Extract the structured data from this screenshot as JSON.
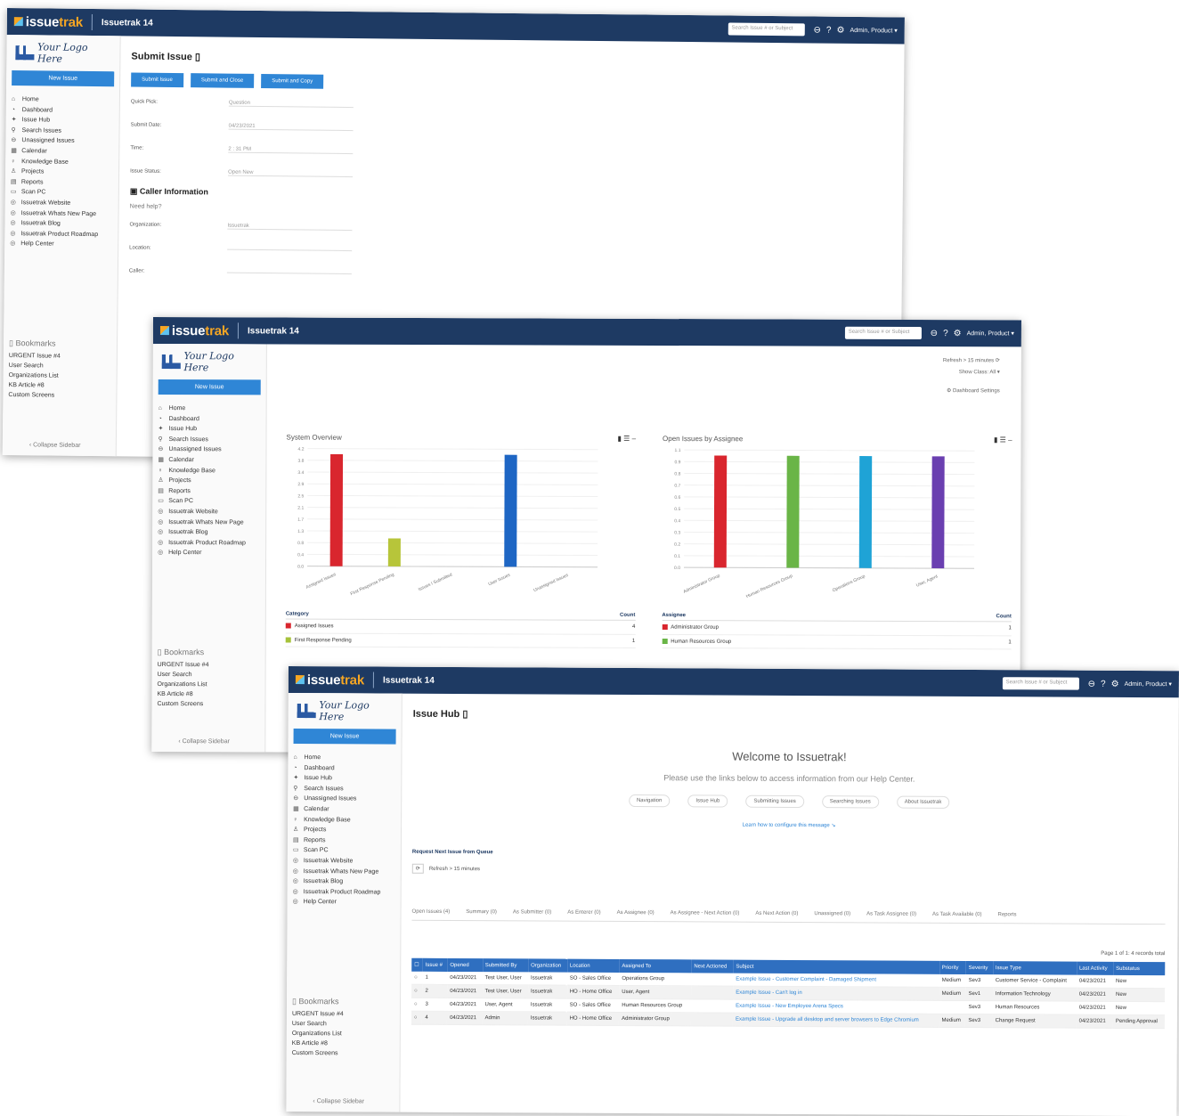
{
  "app": {
    "brand_issue": "issue",
    "brand_trak": "trak",
    "version": "Issuetrak 14",
    "search_placeholder": "Search Issue # or Subject",
    "user_menu": "Admin, Product ▾"
  },
  "sidebar": {
    "logo_text": "Your Logo Here",
    "new_issue": "New Issue",
    "items": [
      {
        "icon": "⌂",
        "label": "Home"
      },
      {
        "icon": "◔",
        "label": "Dashboard"
      },
      {
        "icon": "✦",
        "label": "Issue Hub"
      },
      {
        "icon": "⚲",
        "label": "Search Issues"
      },
      {
        "icon": "⊖",
        "label": "Unassigned Issues"
      },
      {
        "icon": "▦",
        "label": "Calendar"
      },
      {
        "icon": "♀",
        "label": "Knowledge Base"
      },
      {
        "icon": "♙",
        "label": "Projects"
      },
      {
        "icon": "▤",
        "label": "Reports"
      },
      {
        "icon": "▭",
        "label": "Scan PC"
      },
      {
        "icon": "◎",
        "label": "Issuetrak Website"
      },
      {
        "icon": "◎",
        "label": "Issuetrak Whats New Page"
      },
      {
        "icon": "◎",
        "label": "Issuetrak Blog"
      },
      {
        "icon": "◎",
        "label": "Issuetrak Product Roadmap"
      },
      {
        "icon": "◎",
        "label": "Help Center"
      }
    ],
    "bookmarks_title": "Bookmarks",
    "bookmarks": [
      "URGENT Issue #4",
      "User Search",
      "Organizations List",
      "KB Article #8",
      "Custom Screens"
    ],
    "collapse": "‹ Collapse Sidebar"
  },
  "submit": {
    "title": "Submit Issue",
    "buttons": [
      "Submit Issue",
      "Submit and Close",
      "Submit and Copy"
    ],
    "fields": [
      {
        "label": "Quick Pick:",
        "value": "Question"
      },
      {
        "label": "Submit Date:",
        "value": "04/23/2021"
      },
      {
        "label": "Time:",
        "value": "2 : 31 PM"
      },
      {
        "label": "Issue Status:",
        "value": "Open      New"
      }
    ],
    "caller_section": "Caller Information",
    "need_help": "Need help?",
    "caller_fields": [
      {
        "label": "Organization:",
        "value": "Issuetrak"
      },
      {
        "label": "Location:",
        "value": ""
      },
      {
        "label": "Caller:",
        "value": ""
      }
    ]
  },
  "dashboard": {
    "show_class_label": "Show Class:",
    "show_class_value": "All",
    "refresh": "Refresh > 15 minutes",
    "settings": "Dashboard Settings",
    "panels": [
      {
        "title": "System Overview",
        "legend_head": "Category",
        "count_head": "Count",
        "rows": [
          {
            "name": "Assigned Issues",
            "count": "4",
            "color": "#d9262e"
          },
          {
            "name": "First Response Pending",
            "count": "1",
            "color": "#a6c23a"
          }
        ]
      },
      {
        "title": "Open Issues by Assignee",
        "legend_head": "Assignee",
        "count_head": "Count",
        "rows": [
          {
            "name": "Administrator Group",
            "count": "1",
            "color": "#d9262e"
          },
          {
            "name": "Human Resources Group",
            "count": "1",
            "color": "#6ab547"
          }
        ]
      }
    ]
  },
  "chart_data": [
    {
      "type": "bar",
      "title": "System Overview",
      "categories": [
        "Assigned Issues",
        "First Response Pending",
        "Issues I Submitted",
        "User Issues",
        "Unassigned Issues"
      ],
      "values": [
        4,
        1,
        0,
        4,
        0
      ],
      "colors": [
        "#d9262e",
        "#b7c53a",
        "#3a7fd0",
        "#1e66c4",
        "#888888"
      ],
      "ylim": [
        0,
        4.2
      ]
    },
    {
      "type": "bar",
      "title": "Open Issues by Assignee",
      "categories": [
        "Administrator Group",
        "Human Resources Group",
        "Operations Group",
        "User, Agent"
      ],
      "values": [
        1,
        1,
        1,
        1
      ],
      "colors": [
        "#d9262e",
        "#6ab547",
        "#1fa3d6",
        "#6a3fb0"
      ],
      "ylim": [
        0,
        1.05
      ]
    }
  ],
  "hub": {
    "title": "Issue Hub",
    "welcome": "Welcome to Issuetrak!",
    "welcome_sub": "Please use the links below to access information from our Help Center.",
    "chips": [
      "Navigation",
      "Issue Hub",
      "Submitting Issues",
      "Searching Issues",
      "About Issuetrak"
    ],
    "learn": "Learn how to configure this message ↘",
    "queue_head": "Request Next Issue from Queue",
    "refresh": "Refresh > 15 minutes",
    "tabs": [
      "Open Issues (4)",
      "Summary (0)",
      "As Submitter (0)",
      "As Enterer (0)",
      "As Assignee (0)",
      "As Assignee - Next Action (0)",
      "As Next Action (0)",
      "Unassigned (0)",
      "As Task Assignee (0)",
      "As Task Available (0)",
      "Reports"
    ],
    "pager": "Page 1 of 1: 4 records total",
    "columns": [
      "Issue #",
      "Opened",
      "Submitted By",
      "Organization",
      "Location",
      "Assigned To",
      "Next Actioned",
      "Subject",
      "Priority",
      "Severity",
      "Issue Type",
      "Last Activity",
      "Substatus"
    ],
    "rows": [
      [
        "1",
        "04/23/2021",
        "Test User, User",
        "Issuetrak",
        "SO - Sales Office",
        "Operations Group",
        "",
        "Example Issue - Customer Complaint - Damaged Shipment",
        "Medium",
        "Sev3",
        "Customer Service - Complaint",
        "04/23/2021",
        "New"
      ],
      [
        "2",
        "04/23/2021",
        "Test User, User",
        "Issuetrak",
        "HO - Home Office",
        "User, Agent",
        "",
        "Example Issue - Can't log in",
        "Medium",
        "Sev1",
        "Information Technology",
        "04/23/2021",
        "New"
      ],
      [
        "3",
        "04/23/2021",
        "User, Agent",
        "Issuetrak",
        "SO - Sales Office",
        "Human Resources Group",
        "",
        "Example Issue - New Employee Arena Specs",
        "",
        "Sev3",
        "Human Resources",
        "04/23/2021",
        "New"
      ],
      [
        "4",
        "04/23/2021",
        "Admin",
        "Issuetrak",
        "HO - Home Office",
        "Administrator Group",
        "",
        "Example Issue - Upgrade all desktop and server browsers to Edge Chromium",
        "Medium",
        "Sev3",
        "Change Request",
        "04/23/2021",
        "Pending Approval"
      ]
    ]
  }
}
